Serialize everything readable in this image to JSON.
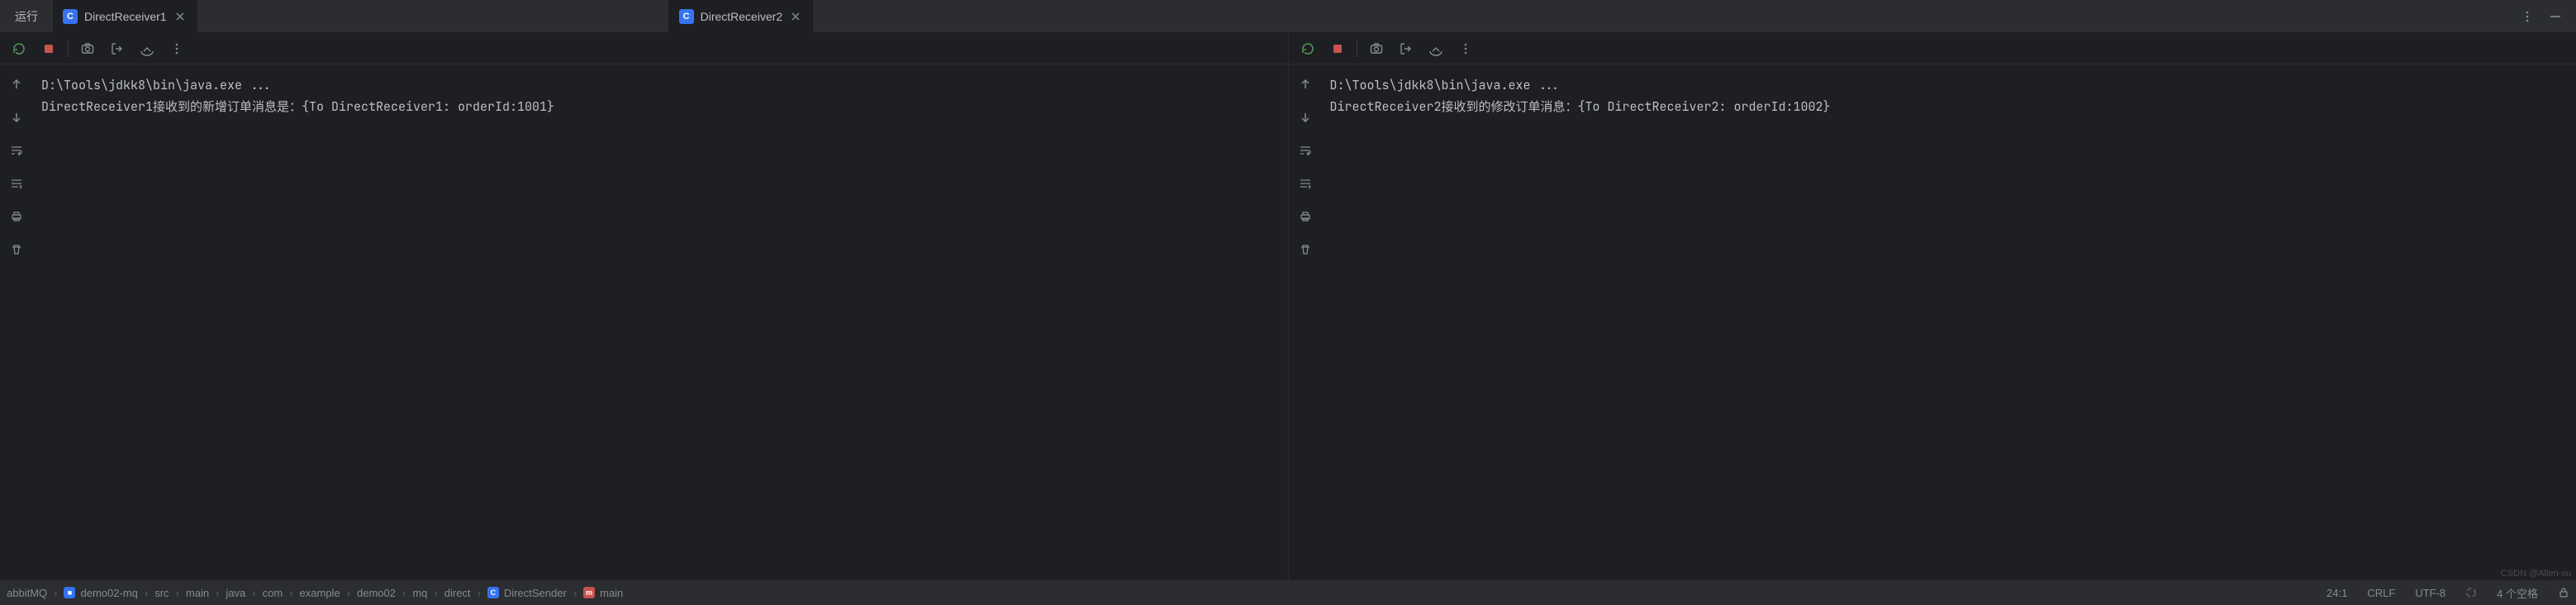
{
  "tabs": {
    "run_label": "运行",
    "tab1": {
      "label": "DirectReceiver1"
    },
    "tab2": {
      "label": "DirectReceiver2"
    }
  },
  "panes": {
    "left": {
      "line1": "D:\\Tools\\jdkk8\\bin\\java.exe ...",
      "line2": "DirectReceiver1接收到的新增订单消息是：{To DirectReceiver1: orderId:1001}"
    },
    "right": {
      "line1": "D:\\Tools\\jdkk8\\bin\\java.exe ...",
      "line2": "DirectReceiver2接收到的修改订单消息：{To DirectReceiver2: orderId:1002}"
    }
  },
  "breadcrumb": {
    "root": "abbitMQ",
    "module": "demo02-mq",
    "p1": "src",
    "p2": "main",
    "p3": "java",
    "p4": "com",
    "p5": "example",
    "p6": "demo02",
    "p7": "mq",
    "p8": "direct",
    "class": "DirectSender",
    "method": "main"
  },
  "status": {
    "pos": "24:1",
    "line_sep": "CRLF",
    "encoding": "UTF-8",
    "indent": "4 个空格"
  },
  "watermark": "CSDN @Allen-xu"
}
